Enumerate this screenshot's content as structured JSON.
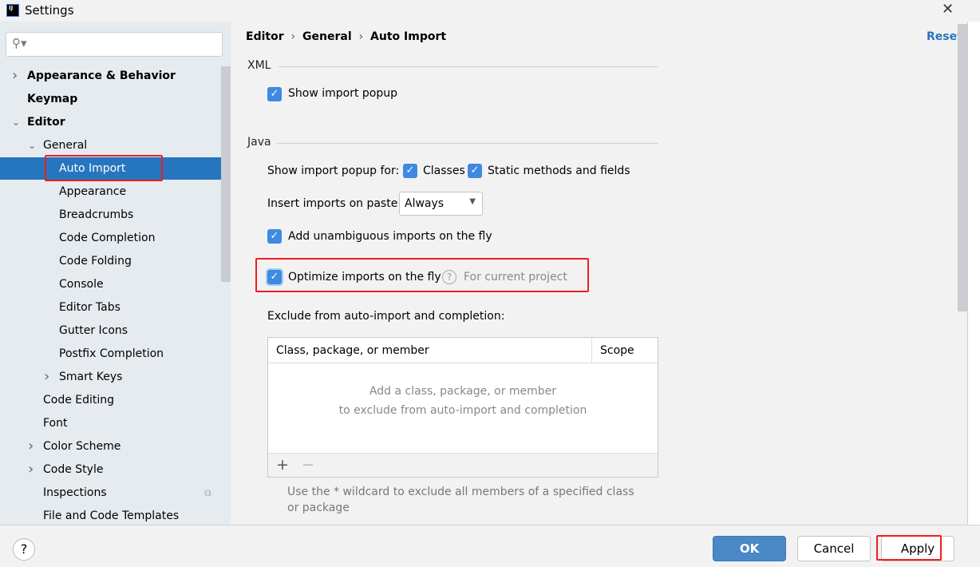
{
  "window": {
    "title": "Settings",
    "app_icon": "IJ"
  },
  "search": {
    "placeholder": ""
  },
  "sidebar": {
    "items": [
      {
        "label": "Appearance & Behavior",
        "bold": true,
        "level": 0,
        "chevron": "right"
      },
      {
        "label": "Keymap",
        "bold": true,
        "level": 0
      },
      {
        "label": "Editor",
        "bold": true,
        "level": 0,
        "chevron": "down"
      },
      {
        "label": "General",
        "level": 1,
        "chevron": "down"
      },
      {
        "label": "Auto Import",
        "level": 2,
        "selected": true
      },
      {
        "label": "Appearance",
        "level": 2
      },
      {
        "label": "Breadcrumbs",
        "level": 2
      },
      {
        "label": "Code Completion",
        "level": 2
      },
      {
        "label": "Code Folding",
        "level": 2
      },
      {
        "label": "Console",
        "level": 2
      },
      {
        "label": "Editor Tabs",
        "level": 2
      },
      {
        "label": "Gutter Icons",
        "level": 2
      },
      {
        "label": "Postfix Completion",
        "level": 2
      },
      {
        "label": "Smart Keys",
        "level": 2,
        "chevron": "right"
      },
      {
        "label": "Code Editing",
        "level": 1
      },
      {
        "label": "Font",
        "level": 1
      },
      {
        "label": "Color Scheme",
        "level": 1,
        "chevron": "right"
      },
      {
        "label": "Code Style",
        "level": 1,
        "chevron": "right"
      },
      {
        "label": "Inspections",
        "level": 1,
        "badge": "copy-icon"
      },
      {
        "label": "File and Code Templates",
        "level": 1
      }
    ]
  },
  "breadcrumb": [
    "Editor",
    "General",
    "Auto Import"
  ],
  "reset_label": "Reset",
  "xml": {
    "title": "XML",
    "show_import_popup": {
      "label": "Show import popup",
      "checked": true
    }
  },
  "java": {
    "title": "Java",
    "popup_for_label": "Show import popup for:",
    "classes": {
      "label": "Classes",
      "checked": true
    },
    "static": {
      "label": "Static methods and fields",
      "checked": true
    },
    "paste_label": "Insert imports on paste:",
    "paste_value": "Always",
    "unambiguous": {
      "label": "Add unambiguous imports on the fly",
      "checked": true
    },
    "optimize": {
      "label": "Optimize imports on the fly",
      "checked": true,
      "hint": "For current project"
    },
    "exclude_label": "Exclude from auto-import and completion:",
    "table": {
      "columns": [
        "Class, package, or member",
        "Scope"
      ],
      "empty_line1": "Add a class, package, or member",
      "empty_line2": "to exclude from auto-import and completion",
      "add": "+",
      "remove": "−"
    },
    "note": "Use the * wildcard to exclude all members of a specified class or package"
  },
  "buttons": {
    "ok": "OK",
    "cancel": "Cancel",
    "apply": "Apply",
    "help": "?"
  },
  "colors": {
    "accent": "#2675bf",
    "highlight": "#f21d1d"
  }
}
